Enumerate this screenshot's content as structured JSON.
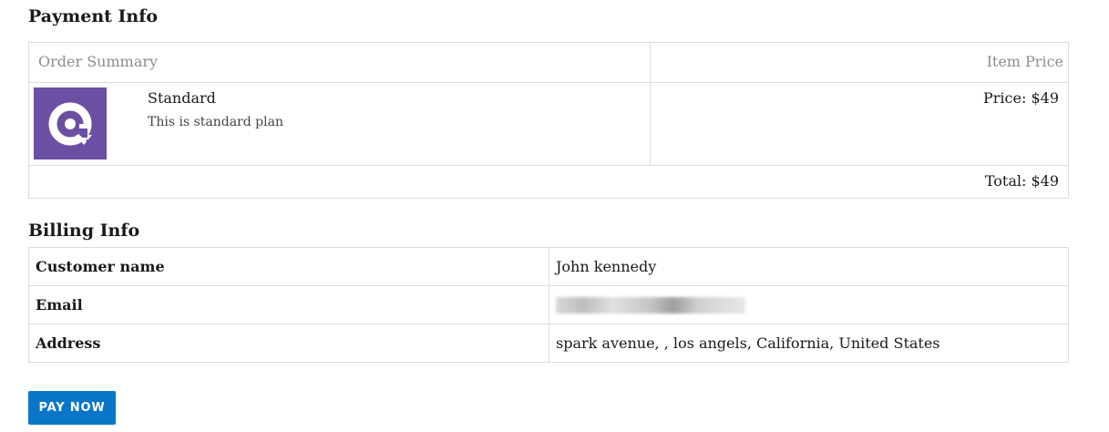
{
  "payment": {
    "title": "Payment Info",
    "header_left": "Order Summary",
    "header_right": "Item Price",
    "item": {
      "name": "Standard",
      "description": "This is standard plan",
      "price": "Price: $49",
      "logo_icon": "app-logo-icon",
      "logo_color": "#6a4fa3"
    },
    "total": "Total: $49"
  },
  "billing": {
    "title": "Billing Info",
    "rows": [
      {
        "label": "Customer name",
        "value": "John kennedy"
      },
      {
        "label": "Email",
        "value": ""
      },
      {
        "label": "Address",
        "value": "spark avenue, , los angels, California, United States"
      }
    ]
  },
  "actions": {
    "pay_label": "PAY NOW",
    "pay_color": "#0a76c9"
  }
}
